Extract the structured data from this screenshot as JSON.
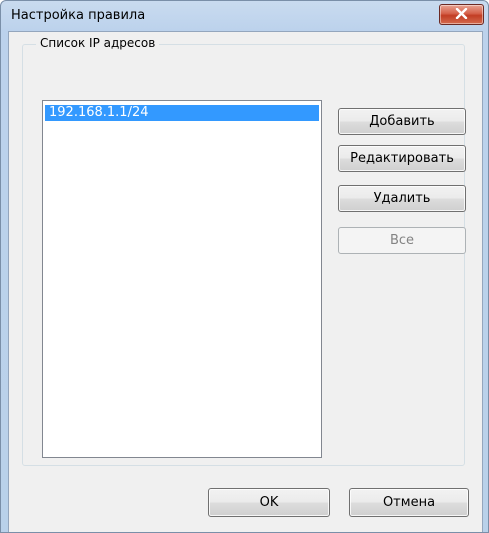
{
  "window": {
    "title": "Настройка правила"
  },
  "group": {
    "legend": "Список IP адресов"
  },
  "ip_list": {
    "items": [
      "192.168.1.1/24"
    ],
    "selected_index": 0
  },
  "buttons": {
    "add": "Добавить",
    "edit": "Редактировать",
    "delete": "Удалить",
    "all": "Все",
    "ok": "OK",
    "cancel": "Отмена"
  },
  "colors": {
    "selection": "#3399ff",
    "close_button": "#c7432a"
  },
  "icons": {
    "close": "close-icon"
  }
}
